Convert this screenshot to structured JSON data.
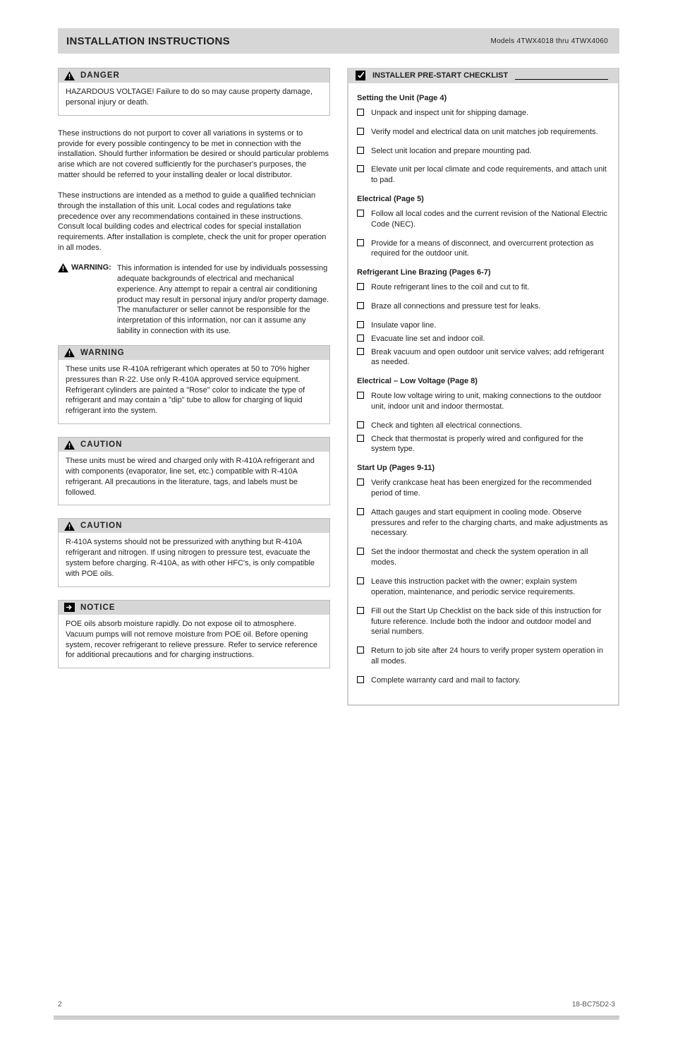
{
  "title": "INSTALLATION INSTRUCTIONS",
  "title_sub": "Models 4TWX4018 thru 4TWX4060",
  "danger": {
    "label": "DANGER",
    "body": "HAZARDOUS VOLTAGE!  Failure to do so may cause property damage, personal injury or death."
  },
  "general_1": "These instructions do not purport to cover all variations in systems or to provide for every possible contingency to be met in connection with the installation. Should further information be desired or should particular problems arise which are not covered sufficiently for the purchaser's purposes, the matter should be referred to your installing dealer or local distributor.",
  "general_2": "These instructions are intended as a method to guide a qualified technician through the installation of this unit. Local codes and regulations take precedence over any recommendations contained in these instructions. Consult local building codes and electrical codes for special installation requirements. After installation is complete, check the unit for proper operation in all modes.",
  "inline_warning": {
    "label": "WARNING:",
    "text": "This information is intended for use by individuals possessing adequate backgrounds of electrical and mechanical experience. Any attempt to repair a central air conditioning product may result in personal injury and/or property damage. The manufacturer or seller cannot be responsible for the interpretation of this information, nor can it assume any liability in connection with its use."
  },
  "warning_box": {
    "label": "WARNING",
    "body": "These units use R-410A refrigerant which operates at 50 to 70% higher pressures than R-22. Use only R-410A approved service equipment. Refrigerant cylinders are painted a \"Rose\" color to indicate the type of refrigerant and may contain a \"dip\" tube to allow for charging of liquid refrigerant into the system."
  },
  "caution1": {
    "label": "CAUTION",
    "body": "These units must be wired and charged only with R-410A refrigerant and with components (evaporator, line set, etc.) compatible with R-410A refrigerant. All precautions in the literature, tags, and labels must be followed."
  },
  "caution2": {
    "label": "CAUTION",
    "body": "R-410A systems should not be pressurized with anything but R-410A refrigerant and nitrogen. If using nitrogen to pressure test, evacuate the system before charging. R-410A, as with other HFC's, is only compatible with POE oils."
  },
  "notice": {
    "label": "NOTICE",
    "body": "POE oils absorb moisture rapidly. Do not expose oil to atmosphere. Vacuum pumps will not remove moisture from POE oil. Before opening system, recover refrigerant to relieve pressure. Refer to service reference for additional precautions and for charging instructions."
  },
  "precheck_title": "INSTALLER PRE-START CHECKLIST",
  "sections": [
    {
      "title": "Setting the Unit (Page 4)",
      "items": [
        "Unpack and inspect unit for shipping damage.",
        "Verify model and electrical data on unit matches job requirements.",
        "Select unit location and prepare mounting pad.",
        "Elevate unit per local climate and code requirements, and attach unit to pad."
      ]
    },
    {
      "title": "Electrical (Page 5)",
      "items": [
        "Follow all local codes and the current revision of the National Electric Code (NEC).",
        "Provide for a means of disconnect, and overcurrent protection as required for the outdoor unit."
      ]
    },
    {
      "title": "Refrigerant Line Brazing (Pages 6-7)",
      "items": [
        "Route refrigerant lines to the coil and cut to fit.",
        "Braze all connections and pressure test for leaks.",
        "Insulate vapor line.",
        "Evacuate line set and indoor coil.",
        "Break vacuum and open outdoor unit service valves; add refrigerant as needed."
      ]
    },
    {
      "title": "Electrical – Low Voltage (Page 8)",
      "items": [
        "Route low voltage wiring to unit, making connections to the outdoor unit, indoor unit and indoor thermostat.",
        "Check and tighten all electrical connections.",
        "Check that thermostat is properly wired and configured for the system type."
      ]
    },
    {
      "title": "Start Up (Pages 9-11)",
      "items": [
        "Verify crankcase heat has been energized for the recommended period of time.",
        "Attach gauges and start equipment in cooling mode. Observe pressures and refer to the charging charts, and make adjustments as necessary.",
        "Set the indoor thermostat and check the system operation in all modes.",
        "Leave this instruction packet with the owner; explain system operation, maintenance, and periodic service requirements.",
        "Fill out the Start Up Checklist on the back side of this instruction for future reference. Include both the indoor and outdoor model and serial numbers.",
        "Return to job site after 24 hours to verify proper system operation in all modes.",
        "Complete warranty card and mail to factory."
      ]
    }
  ],
  "page_left": "2",
  "page_right": "18-BC75D2-3"
}
